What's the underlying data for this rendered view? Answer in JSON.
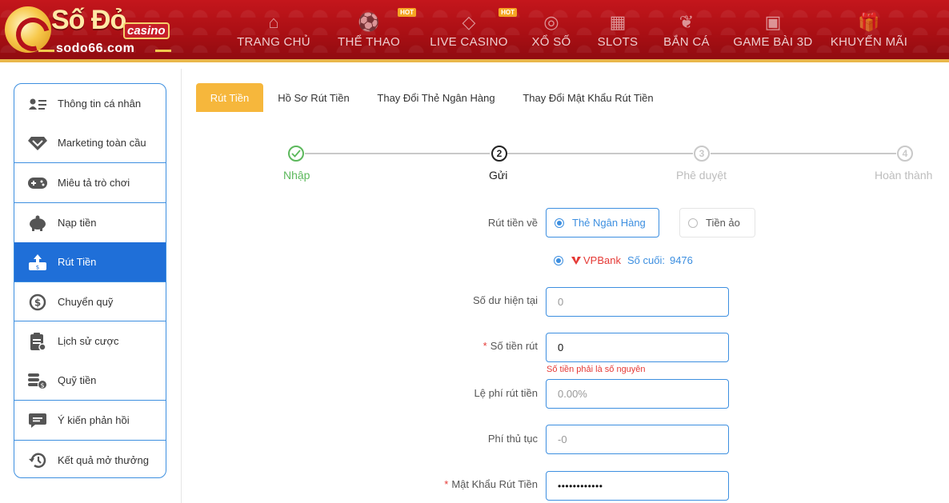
{
  "brand": {
    "name": "Số Đỏ",
    "badge": "casino",
    "url": "sodo66.com"
  },
  "nav": [
    {
      "label": "TRANG CHỦ",
      "icon": "home-icon",
      "hot": false
    },
    {
      "label": "THỂ THAO",
      "icon": "soccer-ball-icon",
      "hot": true
    },
    {
      "label": "LIVE CASINO",
      "icon": "diamond-icon",
      "hot": true
    },
    {
      "label": "XỔ SỐ",
      "icon": "lottery-icon",
      "hot": false
    },
    {
      "label": "SLOTS",
      "icon": "slot-machine-icon",
      "hot": false
    },
    {
      "label": "BẮN CÁ",
      "icon": "fish-icon",
      "hot": false
    },
    {
      "label": "GAME BÀI 3D",
      "icon": "cards-icon",
      "hot": false
    },
    {
      "label": "KHUYẾN MÃI",
      "icon": "gift-icon",
      "hot": false
    }
  ],
  "hot_label": "HOT",
  "sidebar": {
    "items": [
      {
        "label": "Thông tin cá nhân",
        "icon": "id-card-icon",
        "active": false
      },
      {
        "label": "Marketing toàn cầu",
        "icon": "diamond-icon",
        "active": false
      },
      {
        "label": "Miêu tả trò chơi",
        "icon": "gamepad-icon",
        "active": false
      },
      {
        "label": "Nạp tiền",
        "icon": "piggy-bank-icon",
        "active": false
      },
      {
        "label": "Rút Tiền",
        "icon": "withdraw-icon",
        "active": true
      },
      {
        "label": "Chuyển quỹ",
        "icon": "dollar-cycle-icon",
        "active": false
      },
      {
        "label": "Lịch sử cược",
        "icon": "clipboard-icon",
        "active": false
      },
      {
        "label": "Quỹ tiền",
        "icon": "coins-icon",
        "active": false
      },
      {
        "label": "Ý kiến phản hồi",
        "icon": "chat-bubble-icon",
        "active": false
      },
      {
        "label": "Kết quả mở thưởng",
        "icon": "history-icon",
        "active": false
      }
    ]
  },
  "tabs": [
    {
      "label": "Rút Tiền",
      "active": true
    },
    {
      "label": "Hồ Sơ Rút Tiền",
      "active": false
    },
    {
      "label": "Thay Đổi Thẻ Ngân Hàng",
      "active": false
    },
    {
      "label": "Thay Đổi Mật Khẩu Rút Tiền",
      "active": false
    }
  ],
  "steps": [
    {
      "number": "",
      "label": "Nhập",
      "state": "done"
    },
    {
      "number": "2",
      "label": "Gửi",
      "state": "current"
    },
    {
      "number": "3",
      "label": "Phê duyệt",
      "state": "pending"
    },
    {
      "number": "4",
      "label": "Hoàn thành",
      "state": "pending"
    }
  ],
  "form": {
    "withdraw_to_label": "Rút tiền về",
    "option_bank": "Thẻ Ngân Hàng",
    "option_virtual": "Tiền ảo",
    "bank_name": "VPBank",
    "last_digits_label": "Số cuối:",
    "last_digits": "9476",
    "balance_label": "Số dư hiện tại",
    "balance_value": "0",
    "amount_label": "Số tiền rút",
    "amount_value": "0",
    "amount_error": "Số tiền phải là số nguyên",
    "fee_label": "Lệ phí rút tiền",
    "fee_value": "0.00%",
    "proc_fee_label": "Phí thủ tục",
    "proc_fee_value": "-0",
    "password_label": "Mật Khẩu Rút Tiền",
    "password_value": "••••••••••••"
  },
  "colors": {
    "header_red": "#b5121b",
    "accent_blue": "#1f6fd8",
    "tab_orange": "#f6b73c",
    "done_green": "#5cb85c",
    "error_red": "#e53935"
  }
}
